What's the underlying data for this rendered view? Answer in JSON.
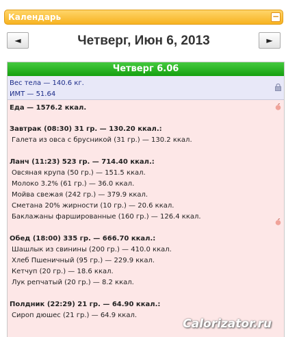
{
  "calendar": {
    "title": "Календарь",
    "collapse_label": "−",
    "prev_label": "◄",
    "next_label": "►",
    "date": "Четверг, Июн 6, 2013"
  },
  "day": {
    "header": "Четверг 6.06",
    "body_weight": "Вес тела — 140.6 кг.",
    "bmi": "ИМТ — 51.64",
    "food_total": "Еда — 1576.2 ккал."
  },
  "meals": {
    "breakfast": {
      "header": "Завтрак (08:30) 31 гр. — 130.20 ккал.:",
      "items": [
        "Галета из овса с брусникой (31 гр.) — 130.2 ккал."
      ]
    },
    "lunch": {
      "header": "Ланч (11:23) 523 гр. — 714.40 ккал.:",
      "items": [
        "Овсяная крупа (50 гр.) — 151.5 ккал.",
        "Молоко 3.2% (61 гр.) — 36.0 ккал.",
        "Мойва свежая (242 гр.) — 379.9 ккал.",
        "Сметана 20% жирности (10 гр.) — 20.6 ккал.",
        "Баклажаны фаршированные (160 гр.) — 126.4 ккал."
      ]
    },
    "dinner": {
      "header": "Обед (18:00) 335 гр. — 666.70 ккал.:",
      "items": [
        "Шашлык из свинины (200 гр.) — 410.0 ккал.",
        "Хлеб Пшеничный (95 гр.) — 229.9 ккал.",
        "Кетчуп (20 гр.) — 18.6 ккал.",
        "Лук репчатый (20 гр.) — 8.2 ккал."
      ]
    },
    "snack": {
      "header": "Полдник (22:29) 21 гр. — 64.90 ккал.:",
      "items": [
        "Сироп дюшес (21 гр.) — 64.9 ккал."
      ]
    }
  },
  "watermark": "Calorizator.ru",
  "icons": {
    "lock": "lock-icon",
    "apple": "apple-icon"
  },
  "colors": {
    "header_orange": "#f7b321",
    "day_green": "#16a010",
    "food_bg": "#fde7e7",
    "stats_bg": "#e8e8f8"
  }
}
